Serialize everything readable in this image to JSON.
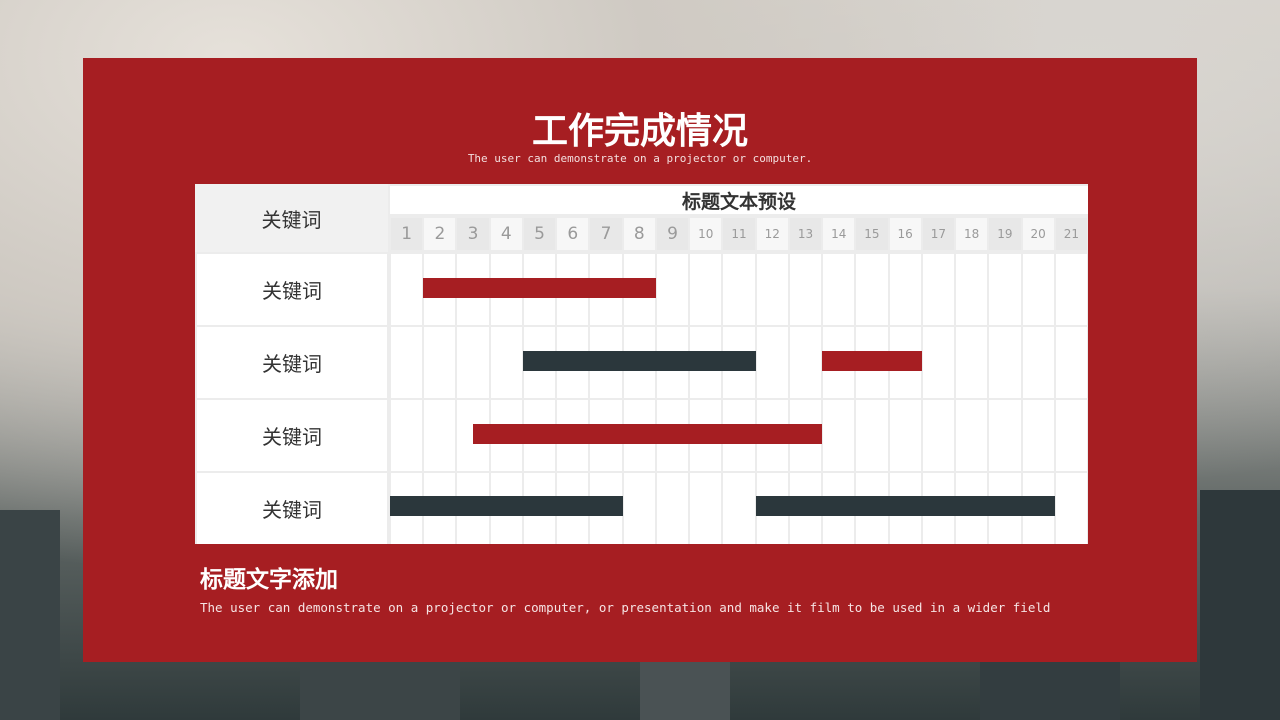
{
  "slide": {
    "title": "工作完成情况",
    "subtitle": "The user can demonstrate on a projector or computer.",
    "footer_title": "标题文字添加",
    "footer_text": "The user can demonstrate on a projector or computer, or presentation and make it film to be used in a wider field"
  },
  "colors": {
    "panel": "#a61e22",
    "bar_red": "#a61e22",
    "bar_dark": "#2b373c",
    "day_shade": "#e8e8e8"
  },
  "chart_data": {
    "type": "gantt",
    "title": "标题文本预设",
    "row_header": "关键词",
    "days": [
      "1",
      "2",
      "3",
      "4",
      "5",
      "6",
      "7",
      "8",
      "9",
      "10",
      "11",
      "12",
      "13",
      "14",
      "15",
      "16",
      "17",
      "18",
      "19",
      "20",
      "21"
    ],
    "shaded_days": [
      1,
      3,
      5,
      7,
      9,
      11,
      13,
      15,
      17,
      19,
      21
    ],
    "rows": [
      {
        "label": "关键词",
        "bars": [
          {
            "start": 2,
            "end": 8,
            "color": "red"
          }
        ]
      },
      {
        "label": "关键词",
        "bars": [
          {
            "start": 5,
            "end": 11,
            "color": "dark"
          },
          {
            "start": 14,
            "end": 16,
            "color": "red"
          }
        ]
      },
      {
        "label": "关键词",
        "bars": [
          {
            "start": 3.5,
            "end": 13,
            "color": "red"
          }
        ]
      },
      {
        "label": "关键词",
        "bars": [
          {
            "start": 1,
            "end": 7,
            "color": "dark"
          },
          {
            "start": 12,
            "end": 20,
            "color": "dark"
          }
        ]
      }
    ]
  }
}
